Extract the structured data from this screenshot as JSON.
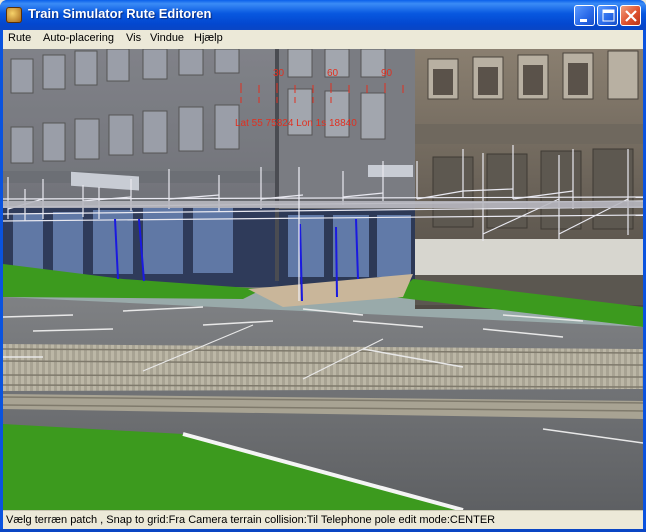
{
  "window": {
    "title": "Train Simulator Rute Editoren"
  },
  "menu": [
    "Rute",
    "Auto-placering",
    "Vis",
    "Vindue",
    "Hjælp"
  ],
  "compass": {
    "ticks": [
      "30",
      "60",
      "90"
    ],
    "coords": "Lat 55 75824 Lon 1s 18840"
  },
  "status": "Vælg terræn patch , Snap to grid:Fra Camera terrain collision:Til Telephone pole edit mode:CENTER",
  "icons": [
    "app-icon",
    "minimize-icon",
    "maximize-icon",
    "close-icon"
  ],
  "colors": {
    "titlebar": "#0A53DF",
    "hud": "#E03020",
    "grass": "#3C9A1E",
    "wire": "#E8E8F0",
    "pole": "#1A1AE0"
  }
}
